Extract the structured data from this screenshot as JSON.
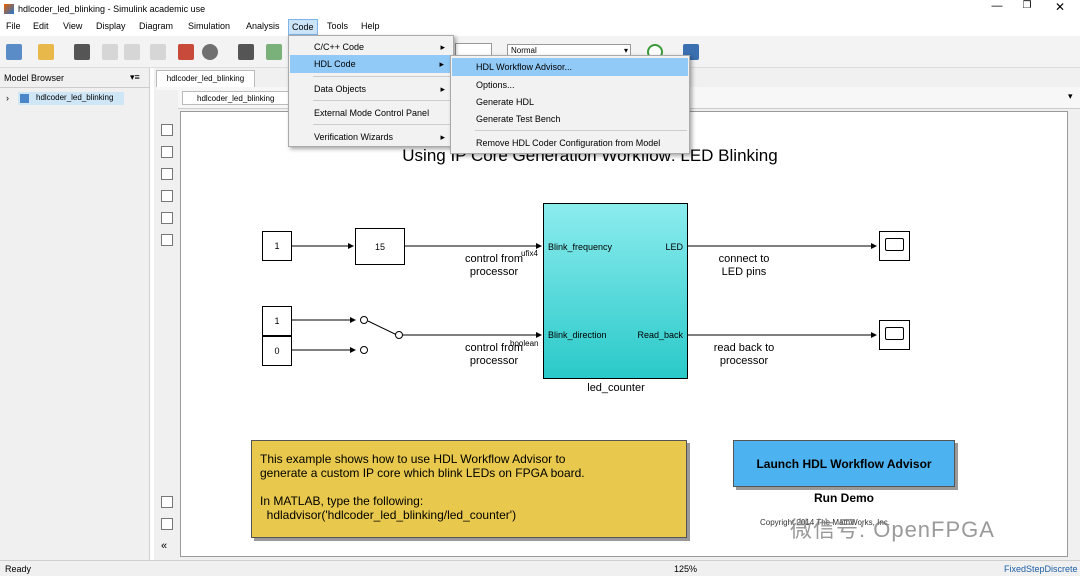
{
  "window": {
    "title": "hdlcoder_led_blinking - Simulink academic use"
  },
  "menubar": [
    "File",
    "Edit",
    "View",
    "Display",
    "Diagram",
    "Simulation",
    "Analysis",
    "Code",
    "Tools",
    "Help"
  ],
  "toolbar": {
    "sim_mode": "Normal"
  },
  "model_browser": {
    "title": "Model Browser",
    "item": "hdlcoder_led_blinking"
  },
  "tabs": {
    "active": "hdlcoder_led_blinking",
    "breadcrumb": "hdlcoder_led_blinking"
  },
  "code_menu": {
    "items": [
      "C/C++ Code",
      "HDL Code",
      "Data Objects",
      "External Mode Control Panel",
      "Verification Wizards"
    ]
  },
  "hdl_submenu": {
    "items": [
      "HDL Workflow Advisor...",
      "Options...",
      "Generate HDL",
      "Generate Test Bench",
      "Remove HDL Coder Configuration from Model"
    ]
  },
  "diagram": {
    "title": "Using IP Core Generation Workflow: LED Blinking",
    "const1": "1",
    "gain": "15",
    "const2": "1",
    "const3": "0",
    "subsystem": {
      "name": "led_counter",
      "in1": "Blink_frequency",
      "in2": "Blink_direction",
      "out1": "LED",
      "out2": "Read_back"
    },
    "sig1": "ufix4",
    "sig2": "boolean",
    "lbl_in1a": "control from",
    "lbl_in1b": "processor",
    "lbl_in2a": "control from",
    "lbl_in2b": "processor",
    "lbl_out1a": "connect to",
    "lbl_out1b": "LED pins",
    "lbl_out2a": "read back to",
    "lbl_out2b": "processor",
    "note": [
      "This example shows how to use HDL Workflow Advisor to",
      "generate a custom IP core which blink LEDs on FPGA board.",
      "",
      "In MATLAB, type the following:",
      "  hdladvisor('hdlcoder_led_blinking/led_counter')"
    ],
    "launch_button": "Launch HDL Workflow Advisor",
    "run_demo": "Run Demo",
    "copyright": "Copyright 2014 The MathWorks, Inc.",
    "watermark": "微信号: OpenFPGA"
  },
  "status": {
    "left": "Ready",
    "zoom": "125%",
    "solver": "FixedStepDiscrete"
  }
}
